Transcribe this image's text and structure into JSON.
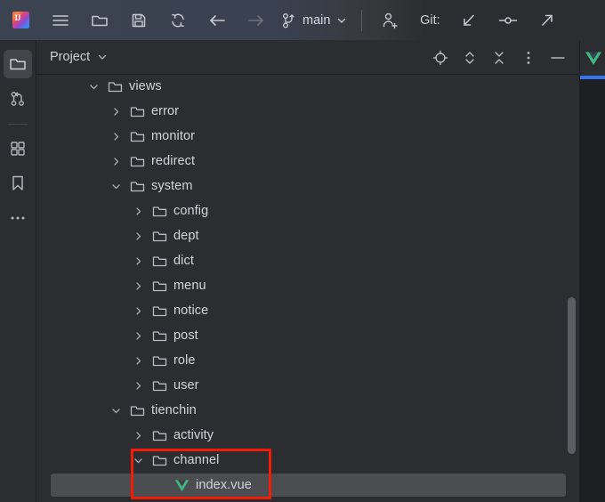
{
  "app": {
    "name": "IntelliJ IDEA",
    "theme_bg": "#2b2d30",
    "accent": "#3574f0",
    "annotation_color": "#f41b06"
  },
  "toolbar": {
    "logo_text": "IJ",
    "logo_name": "intellij-idea-logo",
    "buttons": [
      {
        "name": "main-menu-icon",
        "label": "Main Menu"
      },
      {
        "name": "open-folder-icon",
        "label": "Open"
      },
      {
        "name": "save-all-icon",
        "label": "Save All"
      },
      {
        "name": "sync-refresh-icon",
        "label": "Reload All from Disk"
      },
      {
        "name": "back-arrow-icon",
        "label": "Back"
      },
      {
        "name": "forward-arrow-icon",
        "label": "Forward"
      }
    ],
    "branch_icon": "git-branch-icon",
    "branch_name": "main",
    "branch_chevron": "chevron-down-icon",
    "add_user_icon": "add-user-icon",
    "git_label": "Git:",
    "git_actions": [
      {
        "name": "git-update-icon",
        "label": "Update Project"
      },
      {
        "name": "git-commit-icon",
        "label": "Commit"
      },
      {
        "name": "git-push-icon",
        "label": "Push"
      }
    ]
  },
  "stripe": {
    "items": [
      {
        "name": "sidebar-item-project",
        "label": "Project",
        "icon": "folder-icon",
        "active": true
      },
      {
        "name": "sidebar-item-pull-requests",
        "label": "Pull Requests",
        "icon": "branch-merge-icon",
        "active": false
      },
      {
        "name": "sidebar-item-plugins",
        "label": "Plugins",
        "icon": "grid-squares-icon",
        "active": false
      },
      {
        "name": "sidebar-item-bookmarks",
        "label": "Bookmarks",
        "icon": "bookmark-icon",
        "active": false
      },
      {
        "name": "sidebar-item-more",
        "label": "More Tool Windows",
        "icon": "more-dots-icon",
        "active": false
      }
    ]
  },
  "panel": {
    "title": "Project",
    "title_chevron": "chevron-down-icon",
    "actions": [
      {
        "name": "select-opened-file-button",
        "icon": "locate-target-icon",
        "label": "Select Opened File"
      },
      {
        "name": "expand-collapse-button",
        "icon": "expand-collapse-icon",
        "label": "Expand / Collapse"
      },
      {
        "name": "collapse-all-button",
        "icon": "collapse-all-icon",
        "label": "Collapse All"
      },
      {
        "name": "options-button",
        "icon": "vertical-dots-icon",
        "label": "Options"
      },
      {
        "name": "minimize-button",
        "icon": "minus-icon",
        "label": "Hide"
      }
    ]
  },
  "tree": {
    "rows": [
      {
        "label": "views",
        "depth": 1,
        "state": "expanded",
        "icon": "folder-icon",
        "selected": false
      },
      {
        "label": "error",
        "depth": 2,
        "state": "collapsed",
        "icon": "folder-icon",
        "selected": false
      },
      {
        "label": "monitor",
        "depth": 2,
        "state": "collapsed",
        "icon": "folder-icon",
        "selected": false
      },
      {
        "label": "redirect",
        "depth": 2,
        "state": "collapsed",
        "icon": "folder-icon",
        "selected": false
      },
      {
        "label": "system",
        "depth": 2,
        "state": "expanded",
        "icon": "folder-icon",
        "selected": false
      },
      {
        "label": "config",
        "depth": 3,
        "state": "collapsed",
        "icon": "folder-icon",
        "selected": false
      },
      {
        "label": "dept",
        "depth": 3,
        "state": "collapsed",
        "icon": "folder-icon",
        "selected": false
      },
      {
        "label": "dict",
        "depth": 3,
        "state": "collapsed",
        "icon": "folder-icon",
        "selected": false
      },
      {
        "label": "menu",
        "depth": 3,
        "state": "collapsed",
        "icon": "folder-icon",
        "selected": false
      },
      {
        "label": "notice",
        "depth": 3,
        "state": "collapsed",
        "icon": "folder-icon",
        "selected": false
      },
      {
        "label": "post",
        "depth": 3,
        "state": "collapsed",
        "icon": "folder-icon",
        "selected": false
      },
      {
        "label": "role",
        "depth": 3,
        "state": "collapsed",
        "icon": "folder-icon",
        "selected": false
      },
      {
        "label": "user",
        "depth": 3,
        "state": "collapsed",
        "icon": "folder-icon",
        "selected": false
      },
      {
        "label": "tienchin",
        "depth": 2,
        "state": "expanded",
        "icon": "folder-icon",
        "selected": false
      },
      {
        "label": "activity",
        "depth": 3,
        "state": "collapsed",
        "icon": "folder-icon",
        "selected": false
      },
      {
        "label": "channel",
        "depth": 3,
        "state": "expanded",
        "icon": "folder-icon",
        "selected": false
      },
      {
        "label": "index.vue",
        "depth": 4,
        "state": "leaf",
        "icon": "vue-file-icon",
        "selected": true
      }
    ],
    "scrollbar": {
      "name": "vertical-scrollbar"
    }
  },
  "editor_tabs": {
    "tabs": [
      {
        "name": "editor-tab-index-vue",
        "icon": "vue-file-icon",
        "active": true
      }
    ]
  },
  "annotation": {
    "name": "red-highlight-box",
    "target": "channel folder and index.vue file",
    "color": "#f41b06"
  }
}
